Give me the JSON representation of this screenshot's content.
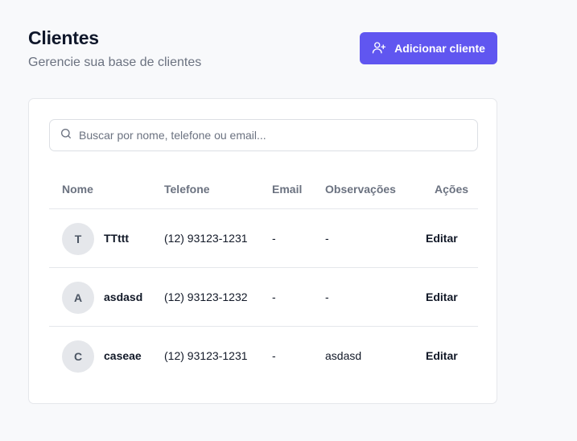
{
  "header": {
    "title": "Clientes",
    "subtitle": "Gerencie sua base de clientes",
    "add_button_label": "Adicionar cliente",
    "add_button_icon": "user-plus-icon"
  },
  "search": {
    "placeholder": "Buscar por nome, telefone ou email...",
    "value": "",
    "icon": "search-icon"
  },
  "table": {
    "columns": [
      "Nome",
      "Telefone",
      "Email",
      "Observações",
      "Ações"
    ],
    "rows": [
      {
        "initial": "T",
        "name": "TTttt",
        "phone": "(12) 93123-1231",
        "email": "-",
        "notes": "-",
        "action": "Editar"
      },
      {
        "initial": "A",
        "name": "asdasd",
        "phone": "(12) 93123-1232",
        "email": "-",
        "notes": "-",
        "action": "Editar"
      },
      {
        "initial": "C",
        "name": "caseae",
        "phone": "(12) 93123-1231",
        "email": "-",
        "notes": "asdasd",
        "action": "Editar"
      }
    ]
  },
  "colors": {
    "accent": "#6056f0",
    "background": "#f8f9fb",
    "muted_text": "#6b7280",
    "avatar_bg": "#e5e7eb"
  }
}
